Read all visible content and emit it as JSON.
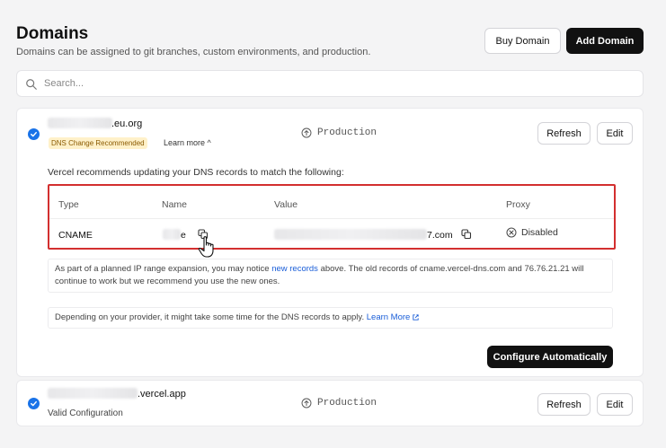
{
  "header": {
    "title": "Domains",
    "subtitle": "Domains can be assigned to git branches, custom environments, and production.",
    "buy_label": "Buy Domain",
    "add_label": "Add Domain"
  },
  "search": {
    "placeholder": "Search..."
  },
  "domains": [
    {
      "suffix": ".eu.org",
      "badge": "DNS Change Recommended",
      "learn_more": "Learn more ^",
      "environment": "Production",
      "refresh_label": "Refresh",
      "edit_label": "Edit",
      "recommendation": "Vercel recommends updating your DNS records to match the following:",
      "dns": {
        "headers": [
          "Type",
          "Name",
          "Value",
          "Proxy"
        ],
        "row": {
          "type": "CNAME",
          "name_suffix": "e",
          "value_suffix": "7.com",
          "proxy": "Disabled"
        }
      },
      "note1_part1": "As part of a planned IP range expansion, you may notice ",
      "note1_link": "new records",
      "note1_part2": " above. The old records of cname.vercel-dns.com and 76.76.21.21 will continue to work but we recommend you use the new ones.",
      "note2_text": "Depending on your provider, it might take some time for the DNS records to apply. ",
      "note2_link": "Learn More",
      "configure_label": "Configure Automatically"
    },
    {
      "suffix": ".vercel.app",
      "status": "Valid Configuration",
      "environment": "Production",
      "refresh_label": "Refresh",
      "edit_label": "Edit"
    }
  ],
  "colors": {
    "accent": "#1a73e8",
    "highlight_border": "#d32f2f",
    "badge_bg": "#fff1c9",
    "link": "#1a5ed8"
  }
}
